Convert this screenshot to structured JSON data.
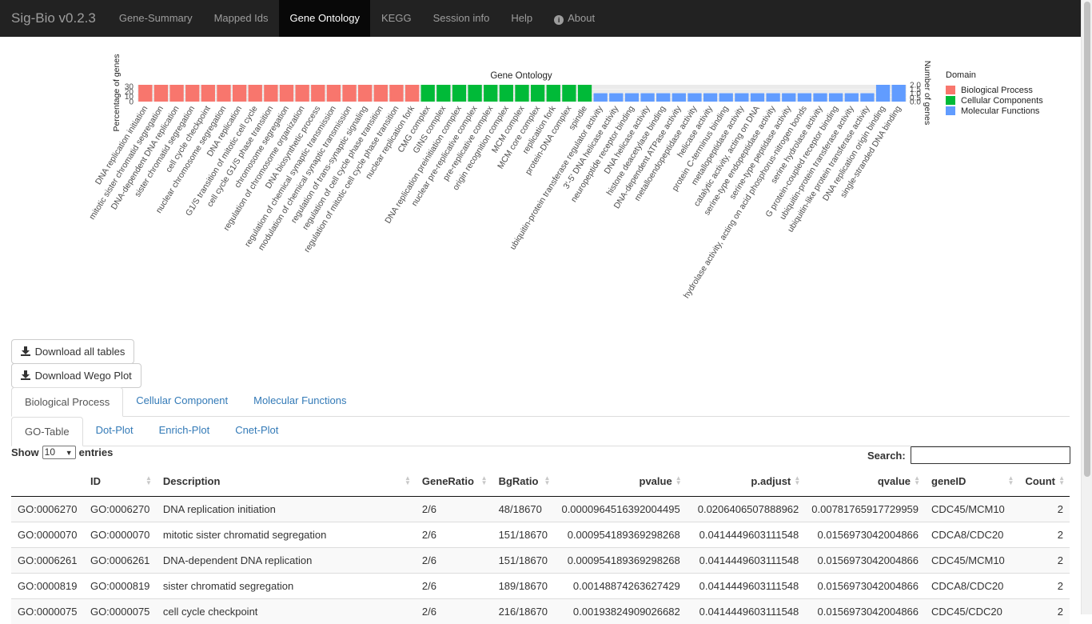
{
  "navbar": {
    "brand": "Sig-Bio v0.2.3",
    "items": [
      "Gene-Summary",
      "Mapped Ids",
      "Gene Ontology",
      "KEGG",
      "Session info",
      "Help",
      "About"
    ],
    "active": "Gene Ontology"
  },
  "chart_data": {
    "type": "bar",
    "title": "Gene Ontology",
    "ylabel_left": "Percentage of genes",
    "ylabel_right": "Number of genes",
    "left_ticks": [
      "30",
      "20",
      "10",
      "0"
    ],
    "right_ticks": [
      "2.0",
      "1.5",
      "1.0",
      "0.5",
      "0.0"
    ],
    "legend_title": "Domain",
    "colors": {
      "Biological Process": "#F8766D",
      "Cellular Components": "#00BA38",
      "Molecular Functions": "#619CFF"
    },
    "series": [
      {
        "name": "Biological Process",
        "categories": [
          "DNA replication initiation",
          "mitotic sister chromatid segregation",
          "DNA-dependent DNA replication",
          "sister chromatid segregation",
          "cell cycle checkpoint",
          "nuclear chromosome segregation",
          "DNA replication",
          "G1/S transition of mitotic cell cycle",
          "cell cycle G1/S phase transition",
          "chromosome segregation",
          "regulation of chromosome organization",
          "DNA biosynthetic process",
          "regulation of chemical synaptic transmission",
          "modulation of chemical synaptic transmission",
          "regulation of trans-synaptic signaling",
          "regulation of cell cycle phase transition",
          "regulation of mitotic cell cycle phase transition",
          "nuclear replication fork"
        ],
        "values": [
          33.3,
          33.3,
          33.3,
          33.3,
          33.3,
          33.3,
          33.3,
          33.3,
          33.3,
          33.3,
          33.3,
          33.3,
          33.3,
          33.3,
          33.3,
          33.3,
          33.3,
          33.3
        ]
      },
      {
        "name": "Cellular Components",
        "categories": [
          "CMG complex",
          "GINS complex",
          "DNA replication preinitiation complex",
          "nuclear pre-replicative complex",
          "pre-replicative complex",
          "origin recognition complex",
          "MCM complex",
          "MCM core complex",
          "replication fork",
          "protein-DNA complex",
          "spindle"
        ],
        "values": [
          33.3,
          33.3,
          33.3,
          33.3,
          33.3,
          33.3,
          33.3,
          33.3,
          33.3,
          33.3,
          33.3
        ]
      },
      {
        "name": "Molecular Functions",
        "categories": [
          "ubiquitin-protein transferase regulator activity",
          "3'-5' DNA helicase activity",
          "neuropeptide receptor binding",
          "DNA helicase activity",
          "histone deacetylase binding",
          "DNA-dependent ATPase activity",
          "metalloendopeptidase activity",
          "helicase activity",
          "protein C-terminus binding",
          "metallopeptidase activity",
          "catalytic activity, acting on DNA",
          "serine-type endopeptidase activity",
          "serine-type peptidase activity",
          "hydrolase activity, acting on acid phosphorus-nitrogen bonds",
          "serine hydrolase activity",
          "G protein-coupled receptor binding",
          "ubiquitin-protein transferase activity",
          "ubiquitin-like protein transferase activity",
          "DNA replication origin binding",
          "single-stranded DNA binding"
        ],
        "values": [
          1,
          1,
          1,
          1,
          1,
          1,
          1,
          1,
          1,
          1,
          1,
          1,
          1,
          1,
          1,
          1,
          1,
          1,
          2,
          2
        ]
      }
    ]
  },
  "buttons": {
    "download_tables": "Download all tables",
    "download_wego": "Download Wego Plot"
  },
  "domain_tabs": [
    "Biological Process",
    "Cellular Component",
    "Molecular Functions"
  ],
  "view_tabs": [
    "GO-Table",
    "Dot-Plot",
    "Enrich-Plot",
    "Cnet-Plot"
  ],
  "table_controls": {
    "show": "Show",
    "entries_value": "10",
    "entries": "entries",
    "search": "Search:"
  },
  "table": {
    "columns": [
      "",
      "ID",
      "Description",
      "GeneRatio",
      "BgRatio",
      "pvalue",
      "p.adjust",
      "qvalue",
      "geneID",
      "Count"
    ],
    "rows": [
      [
        "GO:0006270",
        "GO:0006270",
        "DNA replication initiation",
        "2/6",
        "48/18670",
        "0.0000964516392004495",
        "0.0206406507888962",
        "0.00781765917729959",
        "CDC45/MCM10",
        "2"
      ],
      [
        "GO:0000070",
        "GO:0000070",
        "mitotic sister chromatid segregation",
        "2/6",
        "151/18670",
        "0.000954189369298268",
        "0.0414449603111548",
        "0.0156973042004866",
        "CDCA8/CDC20",
        "2"
      ],
      [
        "GO:0006261",
        "GO:0006261",
        "DNA-dependent DNA replication",
        "2/6",
        "151/18670",
        "0.000954189369298268",
        "0.0414449603111548",
        "0.0156973042004866",
        "CDC45/MCM10",
        "2"
      ],
      [
        "GO:0000819",
        "GO:0000819",
        "sister chromatid segregation",
        "2/6",
        "189/18670",
        "0.00148874263627429",
        "0.0414449603111548",
        "0.0156973042004866",
        "CDCA8/CDC20",
        "2"
      ],
      [
        "GO:0000075",
        "GO:0000075",
        "cell cycle checkpoint",
        "2/6",
        "216/18670",
        "0.00193824909026682",
        "0.0414449603111548",
        "0.0156973042004866",
        "CDC45/CDC20",
        "2"
      ]
    ]
  }
}
